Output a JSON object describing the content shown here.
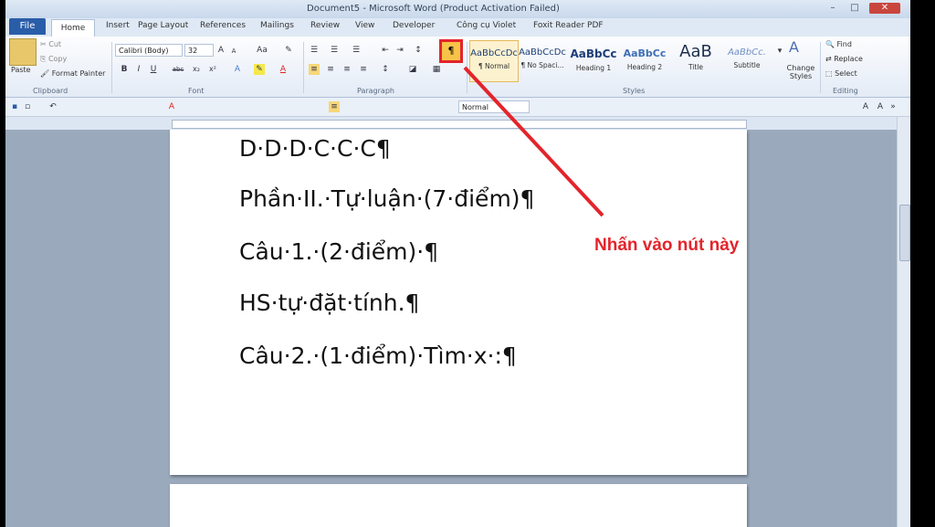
{
  "window": {
    "title": "Document5 - Microsoft Word (Product Activation Failed)"
  },
  "tabs": [
    "File",
    "Home",
    "Insert",
    "Page Layout",
    "References",
    "Mailings",
    "Review",
    "View",
    "Developer",
    "Công cụ Violet",
    "Foxit Reader PDF"
  ],
  "clipboard": {
    "paste": "Paste",
    "cut": "Cut",
    "copy": "Copy",
    "format_painter": "Format Painter",
    "label": "Clipboard"
  },
  "font": {
    "name": "Calibri (Body)",
    "size": "32",
    "label": "Font",
    "bold": "B",
    "italic": "I",
    "underline": "U",
    "strike": "abc",
    "sub": "x₂",
    "sup": "x²"
  },
  "paragraph": {
    "label": "Paragraph",
    "show_hide": "¶"
  },
  "styles": {
    "label": "Styles",
    "items": [
      {
        "sample": "AaBbCcDc",
        "name": "¶ Normal"
      },
      {
        "sample": "AaBbCcDc",
        "name": "¶ No Spaci..."
      },
      {
        "sample": "AaBbCc",
        "name": "Heading 1"
      },
      {
        "sample": "AaBbCc",
        "name": "Heading 2"
      },
      {
        "sample": "AaB",
        "name": "Title"
      },
      {
        "sample": "AaBbCc.",
        "name": "Subtitle"
      }
    ],
    "change": "Change Styles"
  },
  "editing": {
    "find": "Find",
    "replace": "Replace",
    "select": "Select",
    "label": "Editing"
  },
  "qat": {
    "style_value": "Normal"
  },
  "document": {
    "lines": [
      "D·D·D·C·C·C¶",
      "Phần·II.·Tự·luận·(7·điểm)¶",
      "Câu·1.·(2·điểm)·¶",
      "HS·tự·đặt·tính.¶",
      "Câu·2.·(1·điểm)·Tìm·x·:¶"
    ]
  },
  "annotation": {
    "text": "Nhấn vào nút này",
    "color": "#e3242b"
  }
}
